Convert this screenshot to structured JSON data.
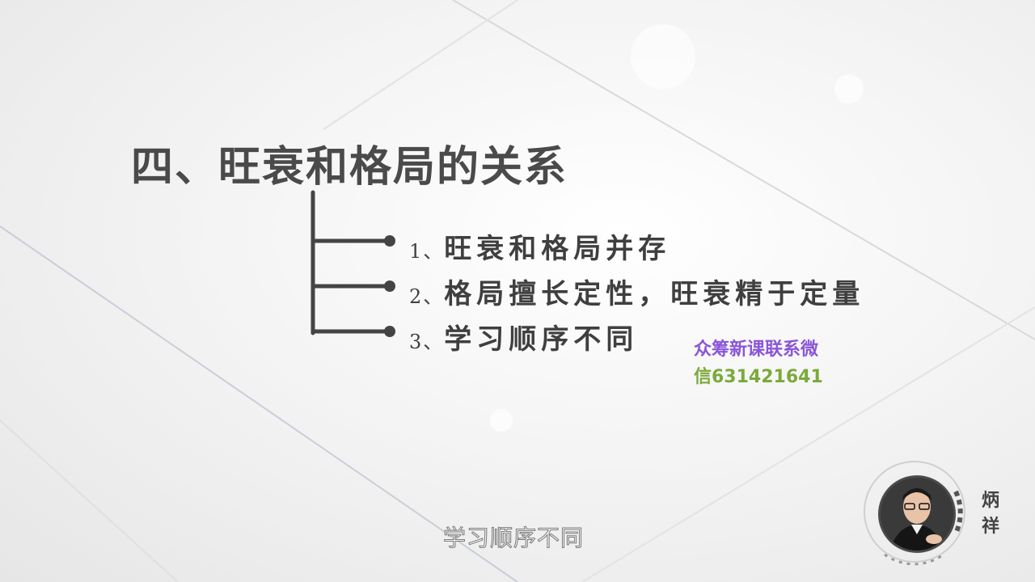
{
  "slide": {
    "title": "四、旺衰和格局的关系",
    "items": [
      {
        "number": "1、",
        "text": "旺衰和格局并存"
      },
      {
        "number": "2、",
        "text": "格局擅长定性，旺衰精于定量"
      },
      {
        "number": "3、",
        "text": "学习顺序不同"
      }
    ]
  },
  "watermark": {
    "line1": "众筹新课联系微",
    "line2": "信631421641"
  },
  "subtitle": "学习顺序不同",
  "presenter": {
    "name_char1": "炳",
    "name_char2": "祥"
  },
  "colors": {
    "title": "#4a4a4a",
    "tree": "#444444",
    "watermark_line1": "#8a56d8",
    "watermark_line2": "#7aaa3a"
  }
}
